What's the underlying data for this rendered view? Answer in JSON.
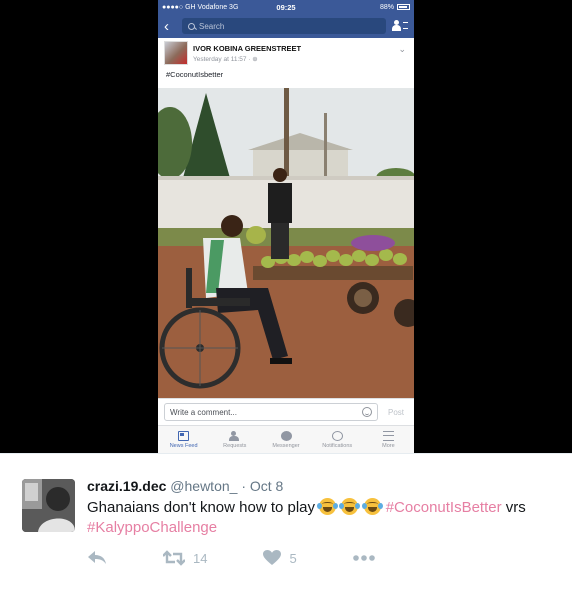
{
  "phone": {
    "status": {
      "carrier": "●●●●○ GH Vodafone  3G",
      "time": "09:25",
      "battery": "88%"
    },
    "search": {
      "placeholder": "Search"
    },
    "post": {
      "author": "IVOR KOBINA GREENSTREET",
      "meta": "Yesterday at 11:57 · ⊕",
      "text": "#CoconutIsbetter"
    },
    "comment": {
      "placeholder": "Write a comment...",
      "post_label": "Post"
    },
    "tabs": [
      {
        "label": "News Feed",
        "icon": "news-feed-icon"
      },
      {
        "label": "Requests",
        "icon": "friend-requests-icon"
      },
      {
        "label": "Messenger",
        "icon": "messenger-icon"
      },
      {
        "label": "Notifications",
        "icon": "globe-icon"
      },
      {
        "label": "More",
        "icon": "menu-icon"
      }
    ]
  },
  "tweet": {
    "display_name": "crazi.19.dec",
    "handle": "@hewton_",
    "separator": "·",
    "date": "Oct 8",
    "text_before": "Ghanaians don't know how to play ",
    "hashtag1": "#CoconutIsBetter",
    "text_mid": " vrs",
    "hashtag2": "#KalyppoChallenge",
    "retweets": "14",
    "likes": "5",
    "colors": {
      "hashtag": "#e67fa3",
      "muted": "#aab8c2",
      "name": "#14171a"
    }
  }
}
